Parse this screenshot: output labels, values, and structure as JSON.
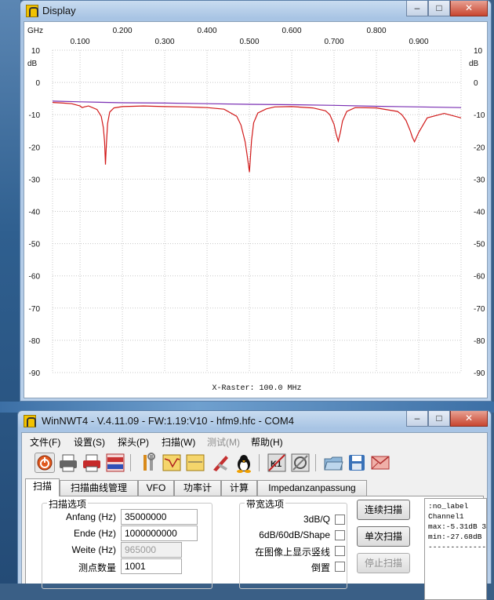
{
  "display_window": {
    "title": "Display",
    "controls": {
      "minimize": "–",
      "maximize": "□",
      "close": "✕"
    }
  },
  "chart_data": {
    "type": "line",
    "x_unit_label": "GHz",
    "y_unit_label": "dB",
    "x_ticks": [
      "0.100",
      "0.200",
      "0.300",
      "0.400",
      "0.500",
      "0.600",
      "0.700",
      "0.800",
      "0.900"
    ],
    "y_ticks": [
      "10",
      "0",
      "-10",
      "-20",
      "-30",
      "-40",
      "-50",
      "-60",
      "-70",
      "-80",
      "-90"
    ],
    "xlim": [
      0.035,
      1.0
    ],
    "ylim": [
      -90,
      10
    ],
    "grid": true,
    "x_raster_text": "X-Raster: 100.0 MHz",
    "series": [
      {
        "color": "#d11a1a",
        "x": [
          0.035,
          0.06,
          0.08,
          0.1,
          0.105,
          0.11,
          0.12,
          0.14,
          0.15,
          0.155,
          0.158,
          0.16,
          0.162,
          0.165,
          0.17,
          0.18,
          0.2,
          0.25,
          0.3,
          0.35,
          0.4,
          0.44,
          0.47,
          0.48,
          0.49,
          0.495,
          0.5,
          0.505,
          0.51,
          0.52,
          0.54,
          0.56,
          0.6,
          0.65,
          0.68,
          0.69,
          0.7,
          0.705,
          0.71,
          0.715,
          0.72,
          0.73,
          0.75,
          0.8,
          0.85,
          0.86,
          0.87,
          0.88,
          0.885,
          0.89,
          0.9,
          0.92,
          0.96,
          1.0
        ],
        "y": [
          -6.2,
          -6.4,
          -6.6,
          -7.3,
          -7.8,
          -7.6,
          -7.3,
          -8.4,
          -10.5,
          -14.0,
          -18.5,
          -25.5,
          -19.5,
          -12.8,
          -9.2,
          -7.9,
          -7.5,
          -7.3,
          -7.5,
          -7.6,
          -7.8,
          -8.3,
          -10.5,
          -13.2,
          -18.5,
          -23.0,
          -27.8,
          -18.0,
          -12.5,
          -9.5,
          -8.2,
          -7.6,
          -7.5,
          -7.9,
          -8.8,
          -10.0,
          -13.0,
          -16.0,
          -18.2,
          -15.5,
          -12.0,
          -9.0,
          -7.8,
          -7.9,
          -9.0,
          -10.0,
          -11.8,
          -15.0,
          -17.0,
          -18.4,
          -15.5,
          -11.0,
          -9.6,
          -11.0
        ]
      },
      {
        "color": "#7a2fb3",
        "x": [
          0.035,
          0.1,
          0.2,
          0.3,
          0.4,
          0.5,
          0.6,
          0.7,
          0.8,
          0.9,
          1.0
        ],
        "y": [
          -5.8,
          -6.0,
          -6.3,
          -6.4,
          -6.6,
          -6.8,
          -6.9,
          -7.1,
          -7.4,
          -7.6,
          -7.8
        ]
      }
    ]
  },
  "main_window": {
    "title": "WinNWT4 - V.4.11.09 - FW:1.19:V10 - hfm9.hfc - COM4",
    "controls": {
      "minimize": "–",
      "maximize": "□",
      "close": "✕"
    }
  },
  "menu": [
    "文件(F)",
    "设置(S)",
    "探头(P)",
    "扫描(W)",
    "测试(M)",
    "帮助(H)"
  ],
  "toolbar_icons": [
    "power-icon",
    "printer-icon",
    "printer-red-icon",
    "png-bmp-icon",
    "tools-icon",
    "chart-icon",
    "db-icon",
    "knife-icon",
    "linux-penguin-icon",
    "k1-icon",
    "calibrate-icon",
    "open-folder-icon",
    "save-icon",
    "envelope-icon"
  ],
  "tabs": [
    "扫描",
    "扫描曲线管理",
    "VFO",
    "功率计",
    "计算",
    "Impedanzanpassung"
  ],
  "scan_options": {
    "title": "扫描选项",
    "start_label": "Anfang (Hz)",
    "start_value": "35000000",
    "end_label": "Ende (Hz)",
    "end_value": "1000000000",
    "width_label": "Weite (Hz)",
    "width_value": "965000",
    "points_label": "测点数量",
    "points_value": "1001"
  },
  "bandwidth_options": {
    "title": "带宽选项",
    "opt1": "3dB/Q",
    "opt2": "6dB/60dB/Shape",
    "opt3": "在图像上显示竖线",
    "opt4": "倒置"
  },
  "buttons": {
    "continuous": "连续扫描",
    "single": "单次扫描",
    "stop": "停止扫描"
  },
  "info_box": {
    "line1": ":no_label",
    "line2": "",
    "line3": "Channel1",
    "line4": "max:-5.31dB 3",
    "line5": "min:-27.68dB",
    "line6": "-------------"
  }
}
